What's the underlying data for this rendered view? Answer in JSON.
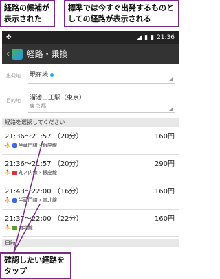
{
  "callouts": {
    "top_left": "経路の候補が表示された",
    "top_right": "標準では今すぐ出発するものとしての経路が表示される",
    "bottom": "確認したい経路をタップ"
  },
  "status": {
    "time": "21:36"
  },
  "appbar": {
    "title": "経路・乗換"
  },
  "departure": {
    "label": "出発地",
    "value": "現在地"
  },
  "destination": {
    "label": "目的地",
    "value": "溜池山王駅（東京）",
    "sub": "東京都"
  },
  "section_routes": "経路を選択してください",
  "routes": [
    {
      "time": "21:36〜21:57 （20分）",
      "price": "160円",
      "lines": "半蔵門線 › 銀座線"
    },
    {
      "time": "21:36〜21:57 （20分）",
      "price": "290円",
      "lines": "丸ノ内線 › 銀座線"
    },
    {
      "time": "21:43〜22:00 （16分）",
      "price": "160円",
      "lines": "半蔵門線 › 南北線"
    },
    {
      "time": "21:37〜22:00 （22分）",
      "price": "160円",
      "lines": "南北線"
    }
  ],
  "section_date": "日時"
}
